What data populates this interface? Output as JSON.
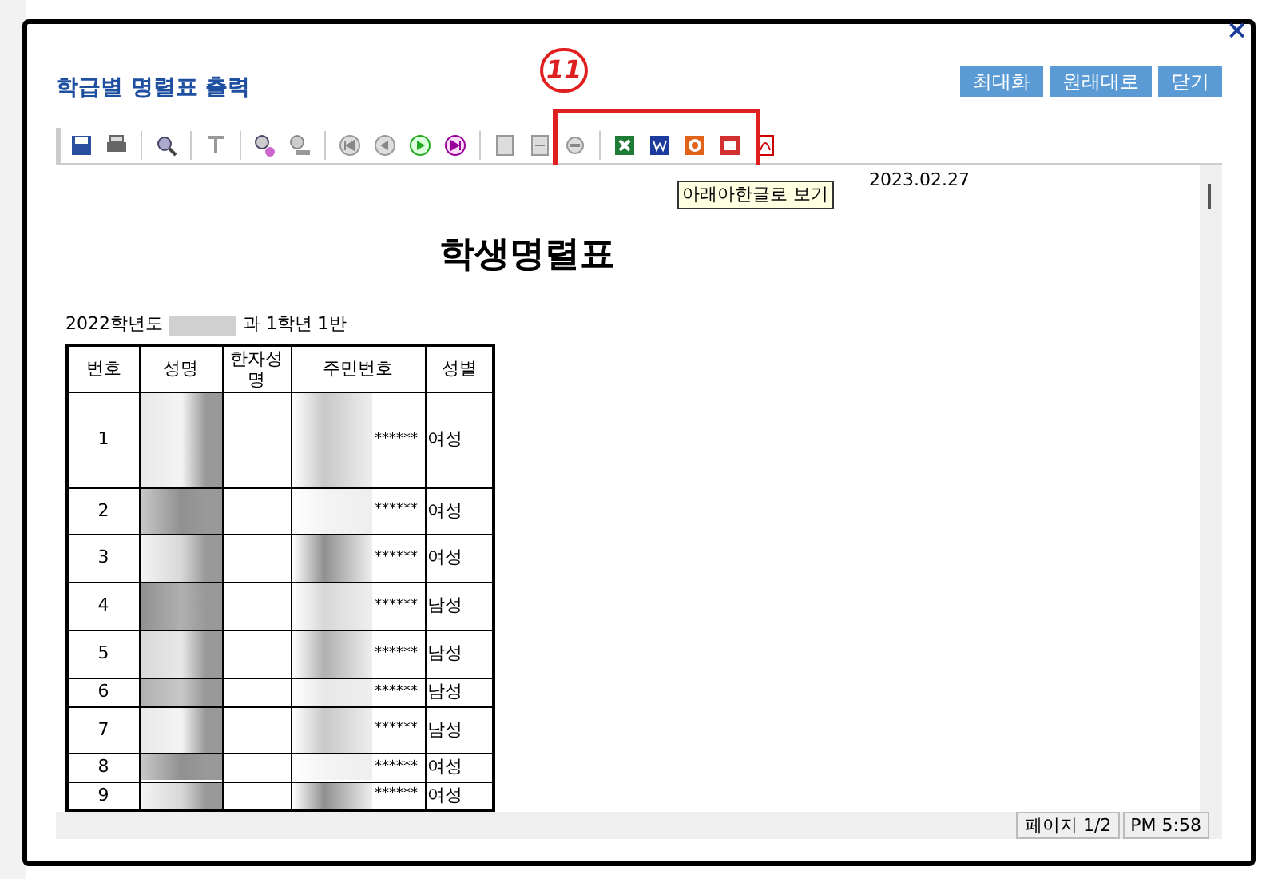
{
  "window": {
    "title": "학급별 명렬표 출력",
    "close": "×",
    "buttons": [
      "최대화",
      "원래대로",
      "닫기"
    ]
  },
  "annotation": {
    "label": "11"
  },
  "tooltip": "아래아한글로 보기",
  "report": {
    "date": "2023.02.27",
    "title": "학생명렬표",
    "subtitle_start": "2022학년도",
    "subtitle_end": "과 1학년 1반",
    "columns": [
      "번호",
      "성명",
      "한자성명",
      "주민번호",
      "성별"
    ],
    "rows": [
      {
        "no": "1",
        "id": "******",
        "gender": "여성"
      },
      {
        "no": "2",
        "id": "******",
        "gender": "여성"
      },
      {
        "no": "3",
        "id": "******",
        "gender": "여성"
      },
      {
        "no": "4",
        "id": "******",
        "gender": "남성"
      },
      {
        "no": "5",
        "id": "******",
        "gender": "남성"
      },
      {
        "no": "6",
        "id": "******",
        "gender": "남성"
      },
      {
        "no": "7",
        "id": "******",
        "gender": "남성"
      },
      {
        "no": "8",
        "id": "******",
        "gender": "여성"
      },
      {
        "no": "9",
        "id": "******",
        "gender": "여성"
      }
    ]
  },
  "status_bar": [
    "페이지 1/2",
    "PM 5:58"
  ]
}
